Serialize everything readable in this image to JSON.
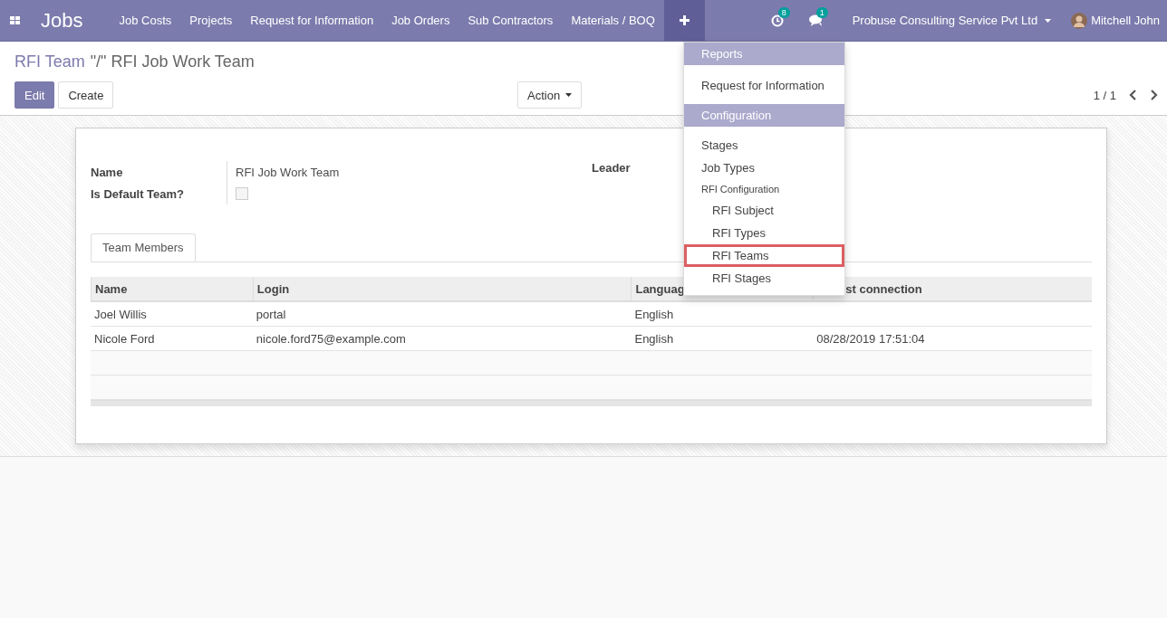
{
  "navbar": {
    "app_title": "Jobs",
    "menu": [
      "Job Costs",
      "Projects",
      "Request for Information",
      "Job Orders",
      "Sub Contractors",
      "Materials / BOQ"
    ],
    "activity_badge": "8",
    "message_badge": "1",
    "company": "Probuse Consulting Service Pvt Ltd",
    "user": "Mitchell John"
  },
  "breadcrumb": {
    "parent": "RFI Team",
    "current": "\"/\" RFI Job Work Team"
  },
  "buttons": {
    "edit": "Edit",
    "create": "Create",
    "action": "Action"
  },
  "pager": "1 / 1",
  "form": {
    "fields": [
      {
        "kind": "text",
        "label": "Name",
        "value": "RFI Job Work Team"
      },
      {
        "kind": "checkbox",
        "label": "Is Default Team?",
        "checked": false
      }
    ],
    "leader_label": "Leader"
  },
  "tabs": [
    {
      "label": "Team Members",
      "selected": true
    }
  ],
  "table": {
    "columns": [
      "Name",
      "Login",
      "Languag",
      "st connection"
    ],
    "rows": [
      [
        "Joel Willis",
        "portal",
        "English",
        ""
      ],
      [
        "Nicole Ford",
        "nicole.ford75@example.com",
        "English",
        "08/28/2019 17:51:04"
      ]
    ]
  },
  "dropdown": [
    {
      "kind": "header",
      "label": "Reports",
      "highlighted": false
    },
    {
      "kind": "item",
      "label": "Request for Information",
      "highlighted": false
    },
    {
      "kind": "header",
      "label": "Configuration",
      "highlighted": false
    },
    {
      "kind": "item",
      "label": "Stages",
      "highlighted": false
    },
    {
      "kind": "item",
      "label": "Job Types",
      "highlighted": false
    },
    {
      "kind": "subheader",
      "label": "RFI Configuration",
      "highlighted": false
    },
    {
      "kind": "subitem",
      "label": "RFI Subject",
      "highlighted": false
    },
    {
      "kind": "subitem",
      "label": "RFI Types",
      "highlighted": false
    },
    {
      "kind": "subitem",
      "label": "RFI Teams",
      "highlighted": true
    },
    {
      "kind": "subitem",
      "label": "RFI Stages",
      "highlighted": false
    }
  ]
}
